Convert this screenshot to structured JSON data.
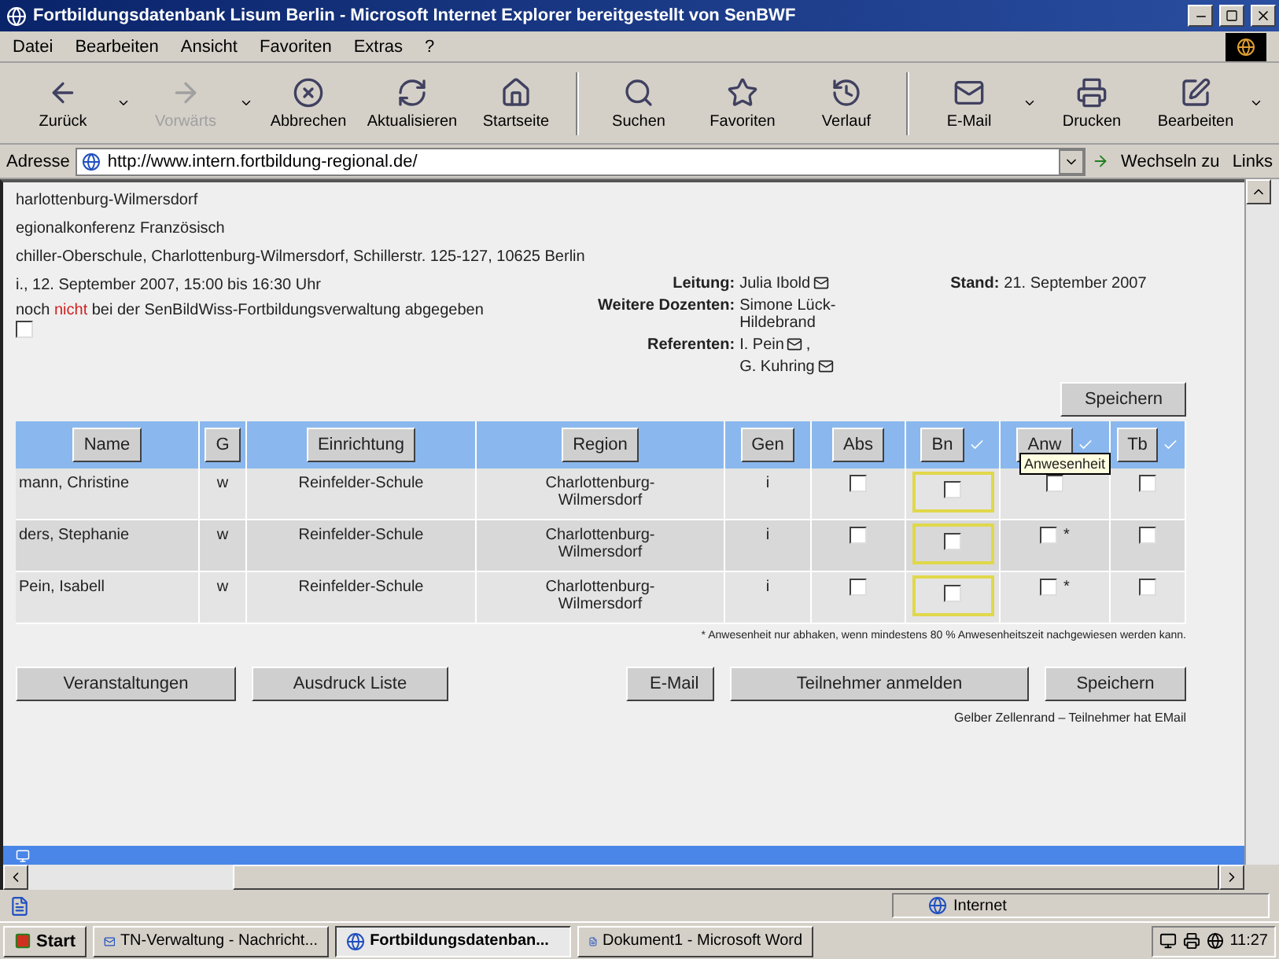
{
  "window": {
    "title": "Fortbildungsdatenbank Lisum Berlin - Microsoft Internet Explorer bereitgestellt von SenBWF"
  },
  "menu": [
    "Datei",
    "Bearbeiten",
    "Ansicht",
    "Favoriten",
    "Extras",
    "?"
  ],
  "toolbar": [
    {
      "label": "Zurück",
      "kind": "back",
      "disabled": false,
      "dropdown": true
    },
    {
      "label": "Vorwärts",
      "kind": "forward",
      "disabled": true,
      "dropdown": true
    },
    {
      "label": "Abbrechen",
      "kind": "stop",
      "disabled": false,
      "dropdown": false
    },
    {
      "label": "Aktualisieren",
      "kind": "refresh",
      "disabled": false,
      "dropdown": false
    },
    {
      "label": "Startseite",
      "kind": "home",
      "disabled": false,
      "dropdown": false
    },
    {
      "label": "Suchen",
      "kind": "search",
      "disabled": false,
      "dropdown": false,
      "separator": true
    },
    {
      "label": "Favoriten",
      "kind": "favorites",
      "disabled": false,
      "dropdown": false
    },
    {
      "label": "Verlauf",
      "kind": "history",
      "disabled": false,
      "dropdown": false
    },
    {
      "label": "E-Mail",
      "kind": "mail",
      "disabled": false,
      "dropdown": true,
      "separator": true
    },
    {
      "label": "Drucken",
      "kind": "print",
      "disabled": false,
      "dropdown": false
    },
    {
      "label": "Bearbeiten",
      "kind": "edit",
      "disabled": false,
      "dropdown": true
    }
  ],
  "address": {
    "label": "Adresse",
    "url": "http://www.intern.fortbildung-regional.de/",
    "go": "Wechseln zu",
    "links": "Links"
  },
  "page": {
    "lines": [
      "harlottenburg-Wilmersdorf",
      "egionalkonferenz Französisch",
      "chiller-Oberschule, Charlottenburg-Wilmersdorf, Schillerstr. 125-127, 10625 Berlin",
      "i., 12. September 2007, 15:00 bis 16:30 Uhr"
    ],
    "status_text": {
      "before": "noch ",
      "highlight": "nicht",
      "after": " bei der SenBildWiss-Fortbildungsverwaltung abgegeben"
    },
    "status_checkbox": {
      "checked": false
    },
    "people": [
      {
        "label": "Leitung:",
        "names": [
          {
            "name": "Julia Ibold",
            "mail": true
          }
        ]
      },
      {
        "label": "Weitere Dozenten:",
        "names": [
          {
            "name": "Simone Lück-Hildebrand",
            "mail": false
          }
        ]
      },
      {
        "label": "Referenten:",
        "names": [
          {
            "name": "I. Pein",
            "mail": true,
            "separator": ","
          },
          {
            "name": "G. Kuhring",
            "mail": true
          }
        ]
      }
    ],
    "stand": {
      "label": "Stand:",
      "value": "21. September 2007"
    },
    "save_top": "Speichern",
    "table": {
      "columns": [
        {
          "label": "Name",
          "check_all": false
        },
        {
          "label": "G",
          "check_all": false
        },
        {
          "label": "Einrichtung",
          "check_all": false
        },
        {
          "label": "Region",
          "check_all": false
        },
        {
          "label": "Gen",
          "check_all": false
        },
        {
          "label": "Abs",
          "check_all": false
        },
        {
          "label": "Bn",
          "check_all": true
        },
        {
          "label": "Anw",
          "check_all": true
        },
        {
          "label": "Tb",
          "check_all": true
        }
      ],
      "tooltip": "Anwesenheit",
      "rows": [
        {
          "name": "mann, Christine",
          "g": "w",
          "einrichtung": "Reinfelder-Schule",
          "region": "Charlottenburg-Wilmersdorf",
          "gen": "i",
          "abs": false,
          "bn": false,
          "email": true,
          "anw": false,
          "anw_note": "",
          "tb": false
        },
        {
          "name": "ders, Stephanie",
          "g": "w",
          "einrichtung": "Reinfelder-Schule",
          "region": "Charlottenburg-Wilmersdorf",
          "gen": "i",
          "abs": false,
          "bn": false,
          "email": true,
          "anw": false,
          "anw_note": "*",
          "tb": false
        },
        {
          "name": "Pein, Isabell",
          "g": "w",
          "einrichtung": "Reinfelder-Schule",
          "region": "Charlottenburg-Wilmersdorf",
          "gen": "i",
          "abs": false,
          "bn": false,
          "email": true,
          "anw": false,
          "anw_note": "*",
          "tb": false
        }
      ]
    },
    "footnote": "* Anwesenheit nur abhaken, wenn mindestens 80 % Anwesenheitszeit nachgewiesen werden kann.",
    "buttons_left": [
      "Veranstaltungen",
      "Ausdruck Liste"
    ],
    "buttons_right": [
      "E-Mail",
      "Teilnehmer anmelden",
      "Speichern"
    ],
    "legend": "Gelber Zellenrand – Teilnehmer hat EMail"
  },
  "status_bar": {
    "zone": "Internet"
  },
  "taskbar": {
    "start": "Start",
    "items": [
      {
        "label": "TN-Verwaltung - Nachricht...",
        "kind": "mail",
        "selected": false
      },
      {
        "label": "Fortbildungsdatenban...",
        "kind": "browser",
        "selected": true
      },
      {
        "label": "Dokument1 - Microsoft Word",
        "kind": "word",
        "selected": false
      }
    ],
    "clock": "11:27"
  }
}
